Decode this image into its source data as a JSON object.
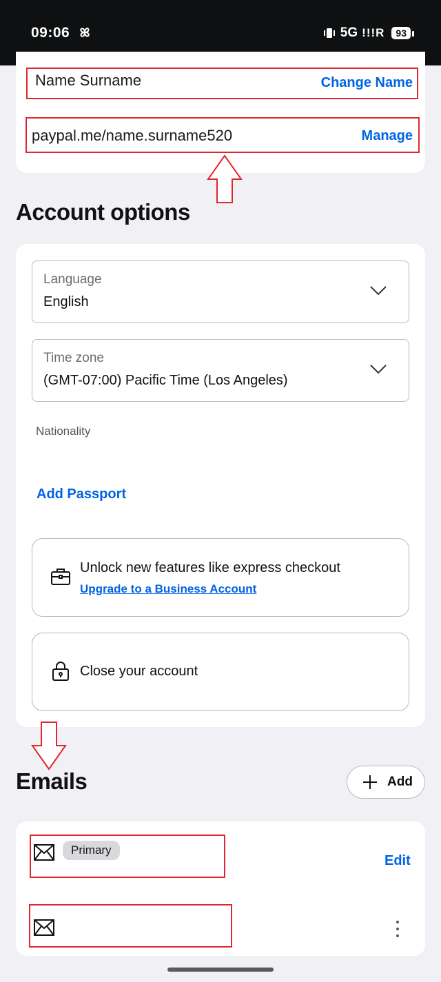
{
  "status_bar": {
    "time": "09:06",
    "network": "5G",
    "signal": "!!!R",
    "battery": "93"
  },
  "profile": {
    "name": "Name Surname",
    "change_name_label": "Change Name",
    "paypal_me_link": "paypal.me/name.surname520",
    "manage_label": "Manage"
  },
  "account_options": {
    "title": "Account options",
    "language": {
      "label": "Language",
      "value": "English"
    },
    "timezone": {
      "label": "Time zone",
      "value": "(GMT-07:00) Pacific Time (Los Angeles)"
    },
    "nationality_label": "Nationality",
    "add_passport_label": "Add Passport",
    "upgrade": {
      "text": "Unlock new features like express checkout",
      "link": "Upgrade to a Business Account"
    },
    "close_account_label": "Close your account"
  },
  "emails": {
    "title": "Emails",
    "add_label": "Add",
    "primary_badge": "Primary",
    "edit_label": "Edit"
  },
  "colors": {
    "link": "#0063e5",
    "highlight": "#e0262e",
    "background": "#f0f0f5"
  },
  "icons": [
    "pinwheel-icon",
    "vibrate-icon",
    "chevron-down-icon",
    "briefcase-icon",
    "lock-icon",
    "plus-icon",
    "envelope-icon",
    "kebab-menu-icon",
    "up-arrow-annotation",
    "down-arrow-annotation"
  ]
}
